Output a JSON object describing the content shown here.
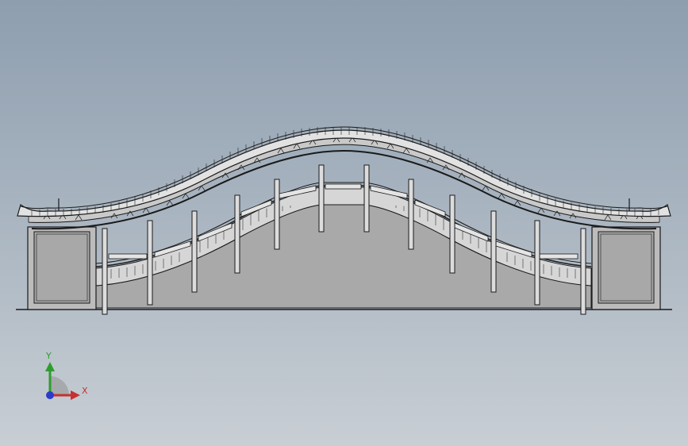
{
  "viewport": {
    "background_top": "#8e9eaf",
    "background_bottom": "#c8ced4"
  },
  "model": {
    "type": "covered arch bridge (corridor) elevation view",
    "line_color": "#1a1a1a",
    "fill_light": "#d3d3d3",
    "fill_mid": "#a9a9a9",
    "fill_panel": "#bdbdbd"
  },
  "triad": {
    "y_label": "Y",
    "x_label": "X",
    "y_color": "#2e9c2e",
    "x_color": "#c63030",
    "z_color": "#2a3cc8"
  }
}
